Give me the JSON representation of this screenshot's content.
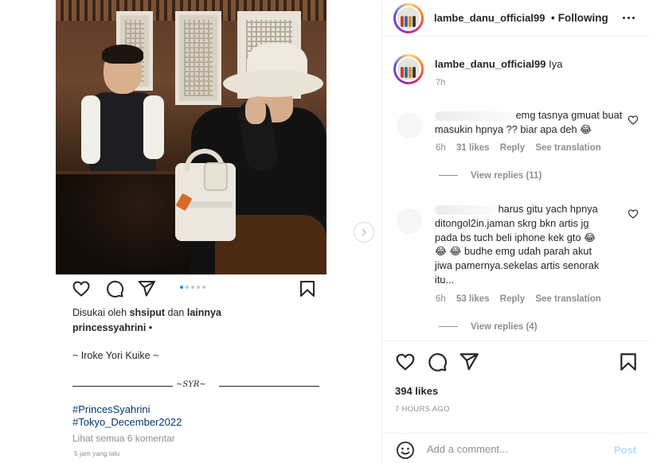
{
  "post_image": {
    "actions": {
      "like": "heart-icon",
      "comment": "comment-icon",
      "share": "share-icon",
      "save": "bookmark-icon"
    },
    "carousel_dots": 5,
    "carousel_active": 0,
    "liked_by_prefix": "Disukai oleh",
    "liked_by_user": "shsiput",
    "liked_by_and": "dan",
    "liked_by_others": "lainnya",
    "caption_user": "princessyahrini",
    "caption_bullet": "•",
    "caption_line": "~ Iroke Yori Kuike ~",
    "separator_mark": "~SYR~",
    "hashtag_1": "#PrincesSyahrini",
    "hashtag_2": "#Tokyo_December2022",
    "view_all": "Lihat semua 6 komentar",
    "time": "5 jam yang lalu"
  },
  "header": {
    "username": "lambe_danu_official99",
    "bullet": "•",
    "follow_status": "Following"
  },
  "caption": {
    "username": "lambe_danu_official99",
    "text": "Iya",
    "time": "7h"
  },
  "comments": [
    {
      "line1": "emg tasnya gmuat buat",
      "line2": "masukin hpnya ?? biar apa deh 😂",
      "time": "6h",
      "likes": "31 likes",
      "reply": "Reply",
      "translate": "See translation",
      "view_replies": "View replies (11)"
    },
    {
      "line1": "harus gitu yach hpnya",
      "line2": "ditongol2in.jaman skrg bkn artis jg",
      "line3": "pada bs tuch beli iphone kek gto 😂",
      "line4": "😂 😂 budhe emg udah parah akut",
      "line5": "jiwa pamernya.sekelas artis senorak",
      "line6": "itu...",
      "time": "6h",
      "likes": "53 likes",
      "reply": "Reply",
      "translate": "See translation",
      "view_replies": "View replies (4)"
    }
  ],
  "stats": {
    "likes": "394 likes",
    "ago": "7 HOURS AGO"
  },
  "comment_input": {
    "placeholder": "Add a comment...",
    "post_label": "Post"
  }
}
